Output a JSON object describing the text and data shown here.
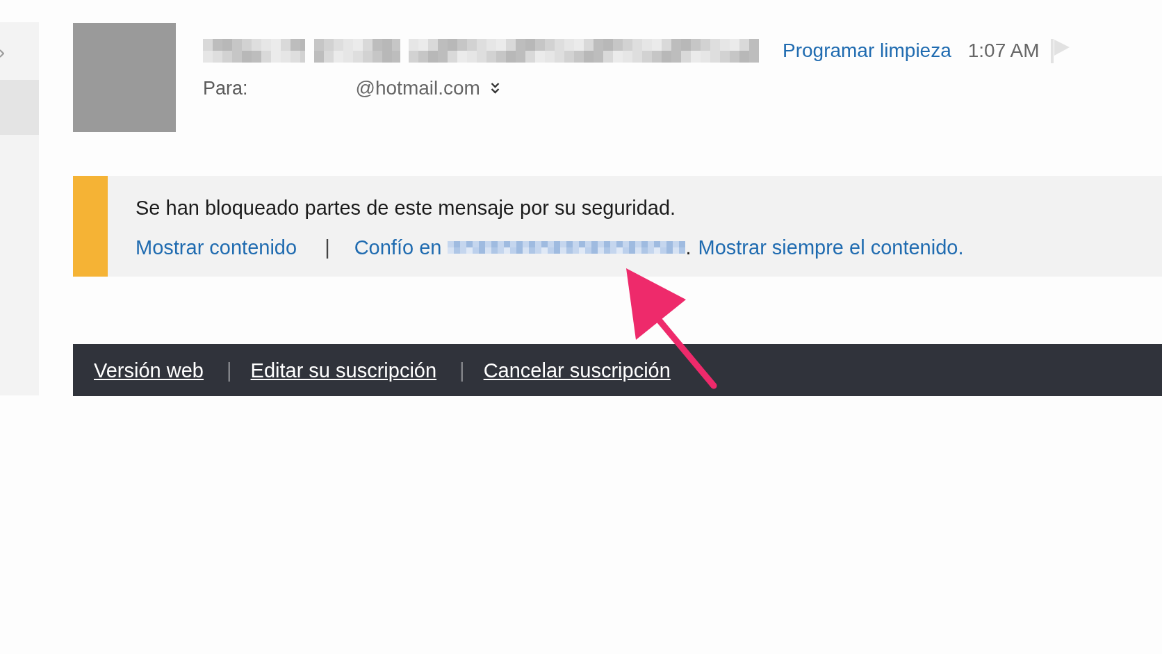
{
  "message_header": {
    "action_link": "Programar limpieza",
    "time": "1:07 AM",
    "recipient_label": "Para:",
    "recipient": "@hotmail.com"
  },
  "security_banner": {
    "message": "Se han bloqueado partes de este mensaje por su seguridad.",
    "actions": [
      {
        "kind": "link",
        "text": "Mostrar contenido"
      },
      {
        "kind": "separator",
        "text": "|"
      },
      {
        "kind": "link",
        "text": "Confío en"
      },
      {
        "kind": "redacted"
      },
      {
        "kind": "text",
        "text": "."
      },
      {
        "kind": "link",
        "text": "Mostrar siempre el contenido."
      }
    ]
  },
  "footer": {
    "items": [
      {
        "kind": "link",
        "text": "Versión web"
      },
      {
        "kind": "separator",
        "text": "|"
      },
      {
        "kind": "link",
        "text": "Editar su suscripción"
      },
      {
        "kind": "separator",
        "text": "|"
      },
      {
        "kind": "link",
        "text": "Cancelar suscripción"
      }
    ]
  }
}
